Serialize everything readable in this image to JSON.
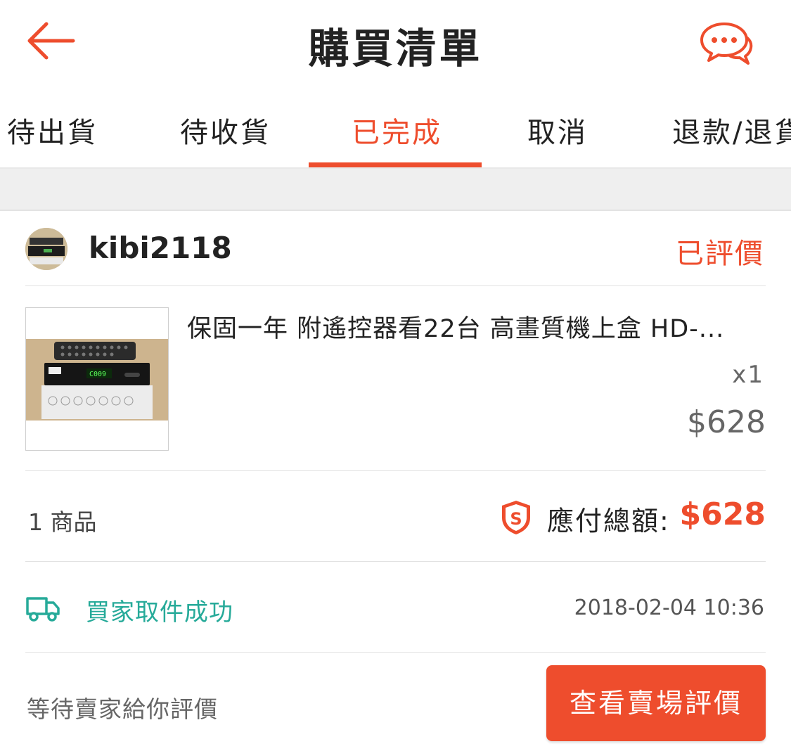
{
  "header": {
    "title": "購買清單",
    "back_icon": "arrow-left-icon",
    "chat_icon": "chat-bubbles-icon"
  },
  "tabs": [
    {
      "label": "待出貨"
    },
    {
      "label": "待收貨"
    },
    {
      "label": "已完成",
      "active": true
    },
    {
      "label": "取消"
    },
    {
      "label": "退款/退貨"
    }
  ],
  "order": {
    "shop_name": "kibi2118",
    "status": "已評價",
    "item": {
      "title": "保固一年 附遙控器看22台 高畫質機上盒 HD-...",
      "qty": "x1",
      "price": "$628"
    },
    "summary": {
      "count": "1 商品",
      "total_label": "應付總額:",
      "total_value": "$628"
    },
    "shipping": {
      "status": "買家取件成功",
      "time": "2018-02-04 10:36"
    },
    "action": {
      "hint": "等待賣家給你評價",
      "button": "查看賣場評價"
    }
  },
  "colors": {
    "accent": "#ee4d2d",
    "ship_green": "#26aa99"
  }
}
